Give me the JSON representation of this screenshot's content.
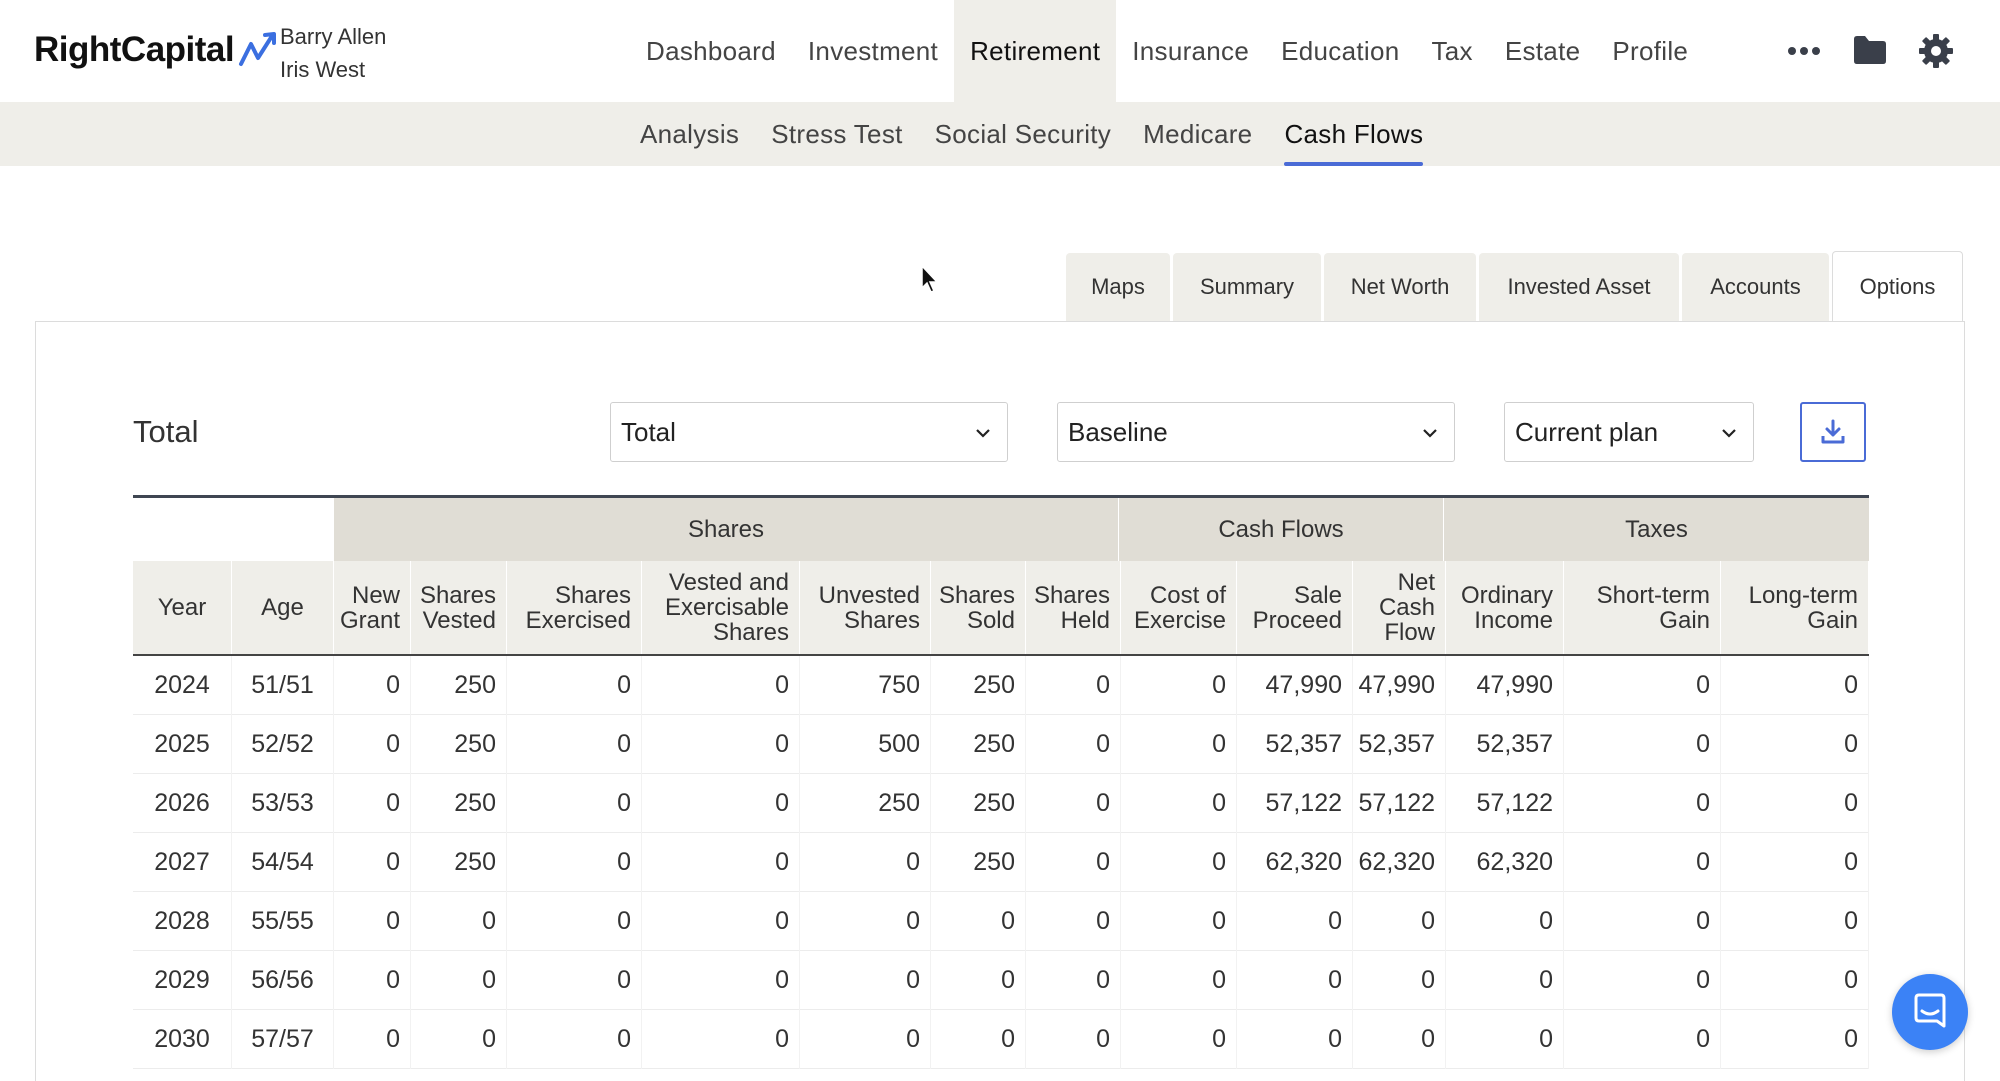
{
  "header": {
    "logo_text": "RightCapital",
    "clients": [
      "Barry Allen",
      "Iris West"
    ],
    "nav": [
      "Dashboard",
      "Investment",
      "Retirement",
      "Insurance",
      "Education",
      "Tax",
      "Estate",
      "Profile"
    ],
    "active_nav": "Retirement",
    "icons": [
      "more-icon",
      "folder-icon",
      "gear-icon"
    ]
  },
  "subnav": {
    "items": [
      "Analysis",
      "Stress Test",
      "Social Security",
      "Medicare",
      "Cash Flows"
    ],
    "active": "Cash Flows"
  },
  "view_tabs": {
    "items": [
      "Maps",
      "Summary",
      "Net Worth",
      "Invested Asset",
      "Accounts",
      "Options"
    ],
    "active": "Options"
  },
  "panel": {
    "title": "Total",
    "selects": {
      "scope": "Total",
      "scenario": "Baseline",
      "plan": "Current plan"
    }
  },
  "table": {
    "groups": [
      "Shares",
      "Cash Flows",
      "Taxes"
    ],
    "columns": [
      "Year",
      "Age",
      "New Grant",
      "Shares Vested",
      "Shares Exercised",
      "Vested and Exercisable Shares",
      "Unvested Shares",
      "Shares Sold",
      "Shares Held",
      "Cost of Exercise",
      "Sale Proceed",
      "Net Cash Flow",
      "Ordinary Income",
      "Short-term Gain",
      "Long-term Gain"
    ],
    "rows": [
      [
        "2024",
        "51/51",
        "0",
        "250",
        "0",
        "0",
        "750",
        "250",
        "0",
        "0",
        "47,990",
        "47,990",
        "47,990",
        "0",
        "0"
      ],
      [
        "2025",
        "52/52",
        "0",
        "250",
        "0",
        "0",
        "500",
        "250",
        "0",
        "0",
        "52,357",
        "52,357",
        "52,357",
        "0",
        "0"
      ],
      [
        "2026",
        "53/53",
        "0",
        "250",
        "0",
        "0",
        "250",
        "250",
        "0",
        "0",
        "57,122",
        "57,122",
        "57,122",
        "0",
        "0"
      ],
      [
        "2027",
        "54/54",
        "0",
        "250",
        "0",
        "0",
        "0",
        "250",
        "0",
        "0",
        "62,320",
        "62,320",
        "62,320",
        "0",
        "0"
      ],
      [
        "2028",
        "55/55",
        "0",
        "0",
        "0",
        "0",
        "0",
        "0",
        "0",
        "0",
        "0",
        "0",
        "0",
        "0",
        "0"
      ],
      [
        "2029",
        "56/56",
        "0",
        "0",
        "0",
        "0",
        "0",
        "0",
        "0",
        "0",
        "0",
        "0",
        "0",
        "0",
        "0"
      ],
      [
        "2030",
        "57/57",
        "0",
        "0",
        "0",
        "0",
        "0",
        "0",
        "0",
        "0",
        "0",
        "0",
        "0",
        "0",
        "0"
      ]
    ]
  },
  "colors": {
    "accent": "#4a6bd6",
    "nav_bg": "#efeee9",
    "group_bg": "#e0ddd5",
    "chat": "#3b82f6"
  }
}
